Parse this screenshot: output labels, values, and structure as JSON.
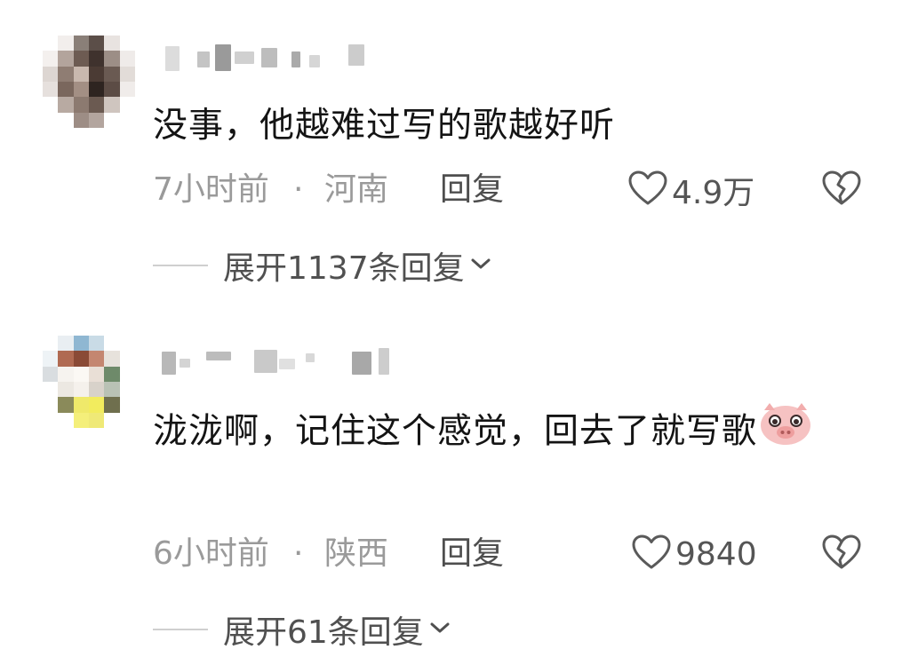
{
  "comments": [
    {
      "text": "没事，他越难过写的歌越好听",
      "time": "7小时前",
      "separator": "·",
      "location": "河南",
      "reply_label": "回复",
      "likes": "4.9万",
      "expand_label": "展开1137条回复"
    },
    {
      "text": "泷泷啊，记住这个感觉，回去了就写歌",
      "time": "6小时前",
      "separator": "·",
      "location": "陕西",
      "reply_label": "回复",
      "likes": "9840",
      "expand_label": "展开61条回复"
    }
  ],
  "icons": {
    "like": "heart-outline-icon",
    "dislike": "broken-heart-icon",
    "expand": "chevron-down-icon",
    "emoji": "pig-face-emoji-icon"
  },
  "colors": {
    "text": "#141414",
    "meta": "#9a9a9a",
    "action": "#4e4e4e",
    "emoji_pink": "#f4b7b7"
  }
}
